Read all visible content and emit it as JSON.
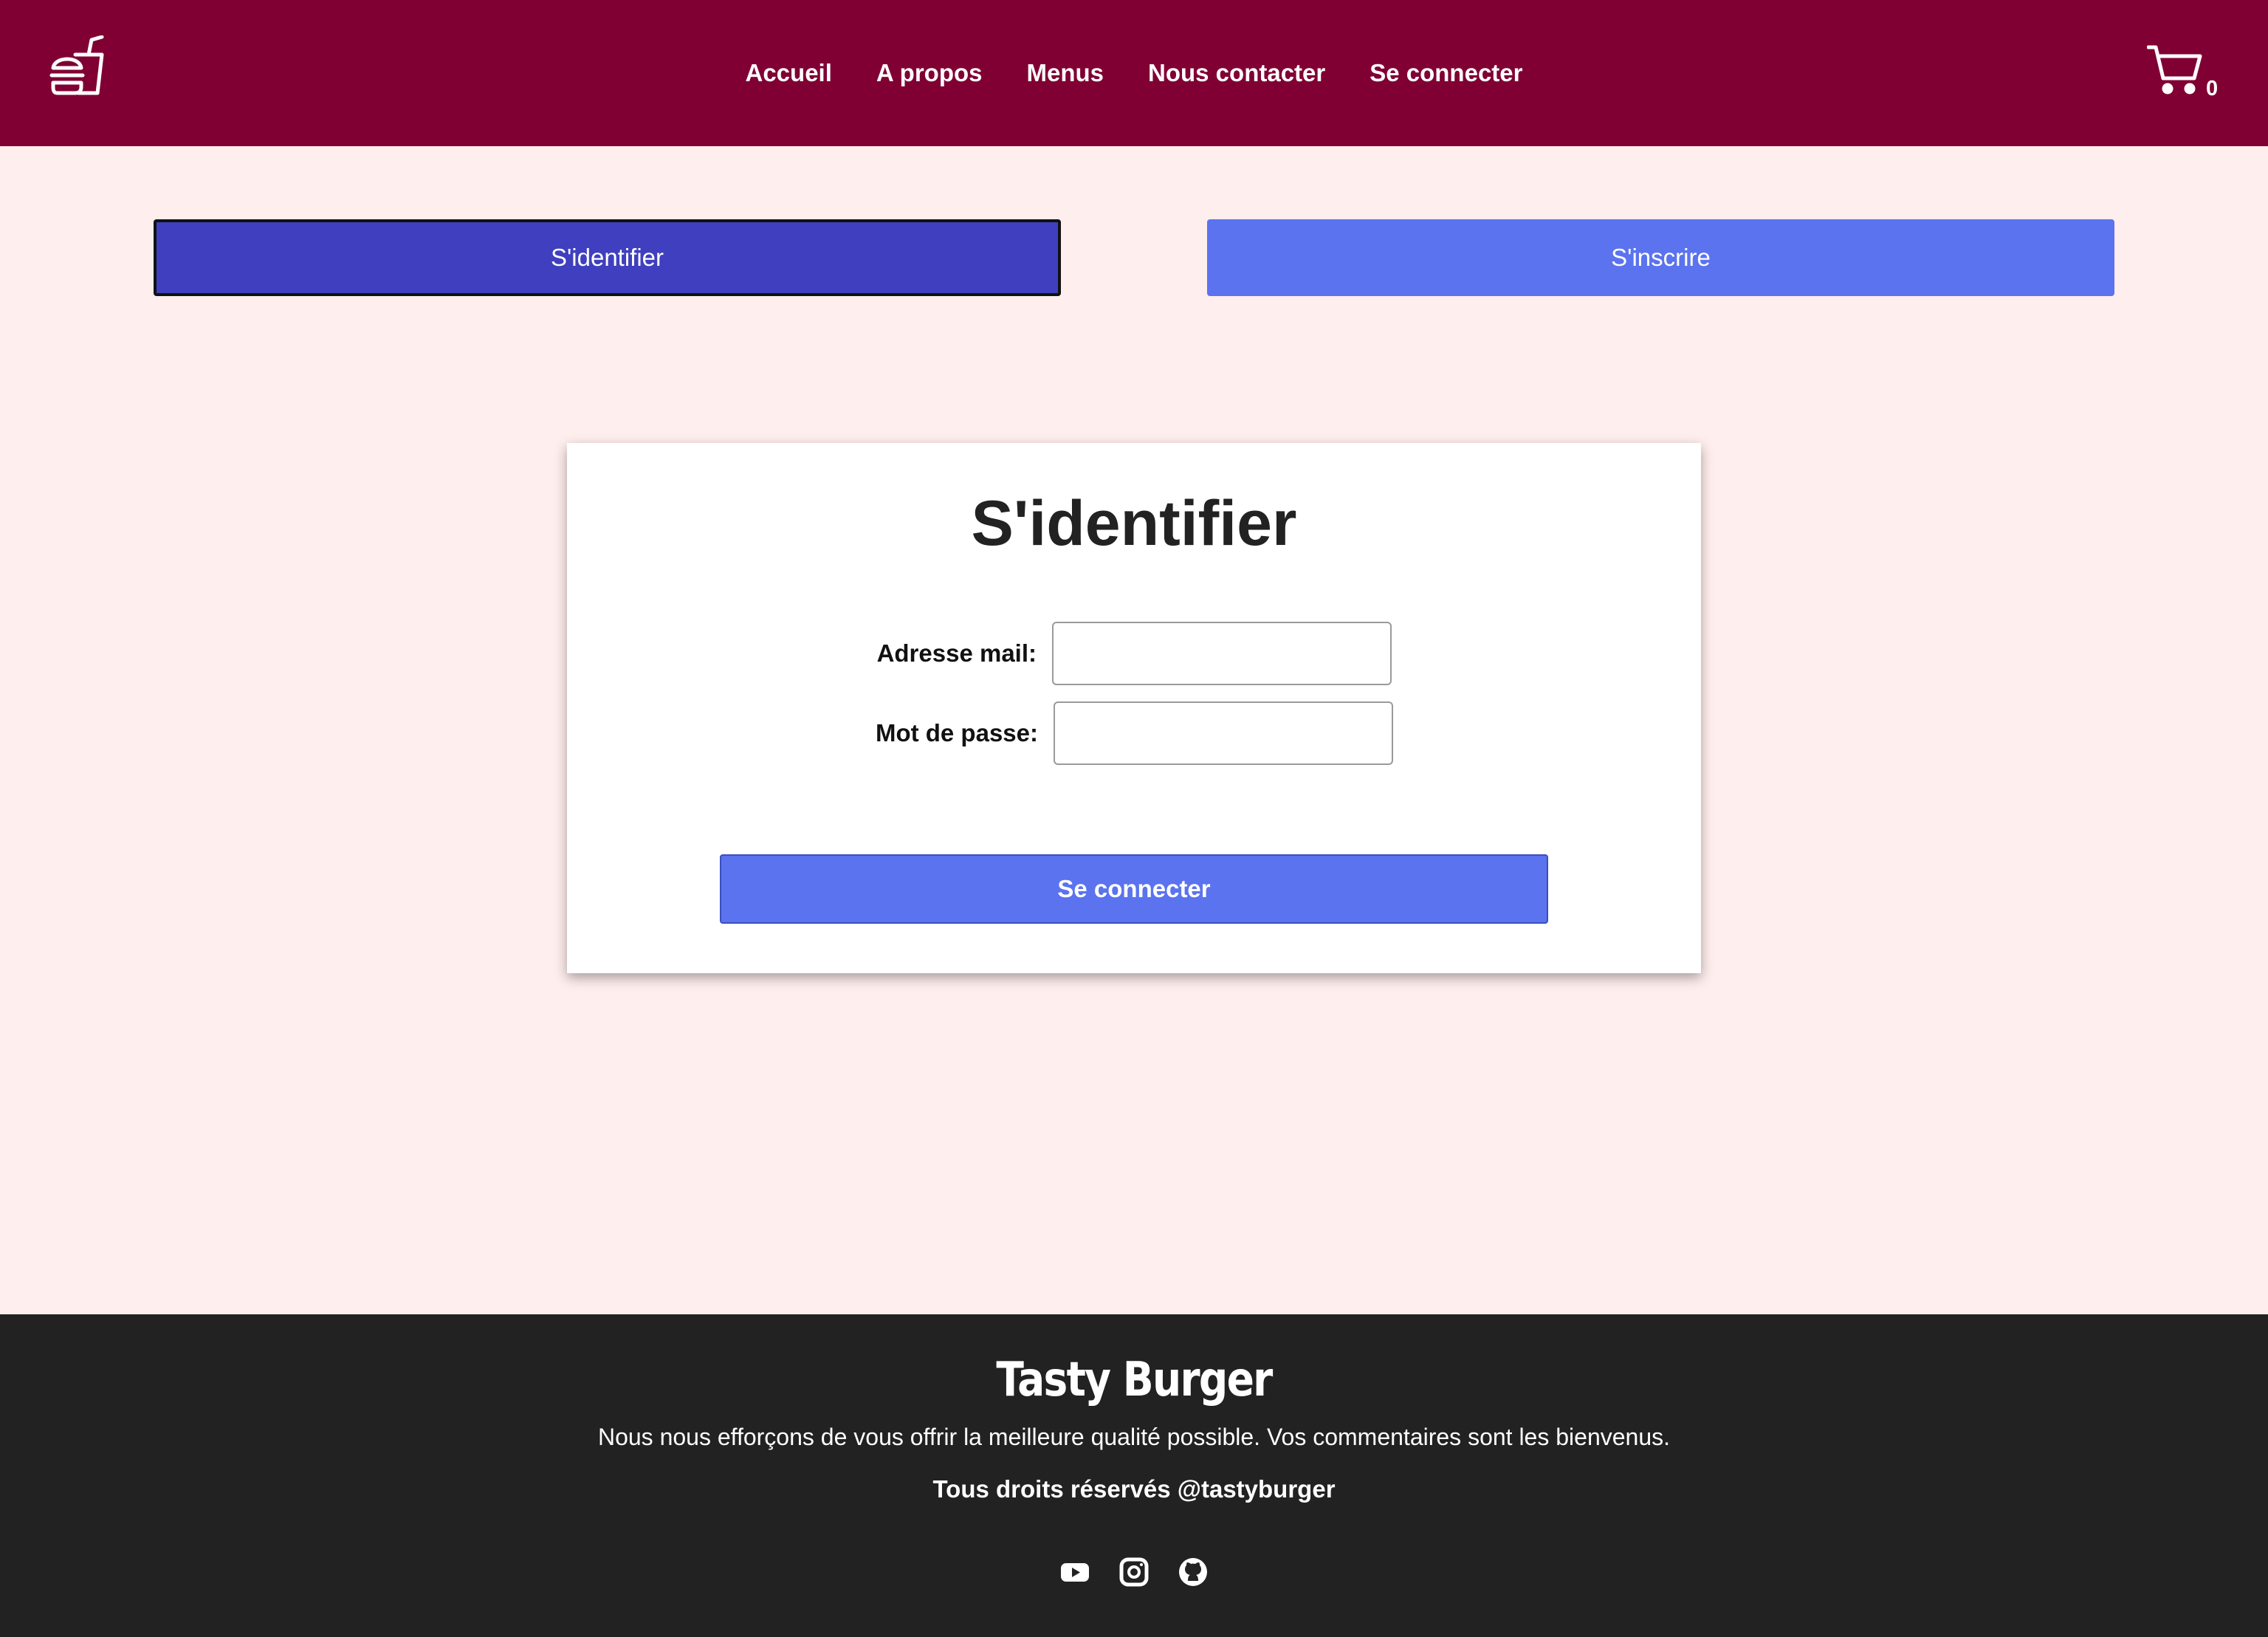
{
  "header": {
    "logo_icon": "burger-drink-icon",
    "nav": [
      {
        "label": "Accueil"
      },
      {
        "label": "A propos"
      },
      {
        "label": "Menus"
      },
      {
        "label": "Nous contacter"
      },
      {
        "label": "Se connecter"
      }
    ],
    "cart_icon": "cart-icon",
    "cart_count": "0",
    "background": "#800033"
  },
  "tabs": {
    "login_label": "S'identifier",
    "register_label": "S'inscrire",
    "login_color": "#3f3fbf",
    "register_color": "#5b73ee"
  },
  "login_form": {
    "title": "S'identifier",
    "email_label": "Adresse mail:",
    "email_value": "",
    "password_label": "Mot de passe:",
    "password_value": "",
    "submit_label": "Se connecter"
  },
  "footer": {
    "brand": "Tasty Burger",
    "tagline": "Nous nous efforçons de vous offrir la meilleure qualité possible. Vos commentaires sont les bienvenus.",
    "rights": "Tous droits réservés @tastyburger",
    "socials": [
      "youtube-icon",
      "instagram-icon",
      "github-icon"
    ]
  }
}
